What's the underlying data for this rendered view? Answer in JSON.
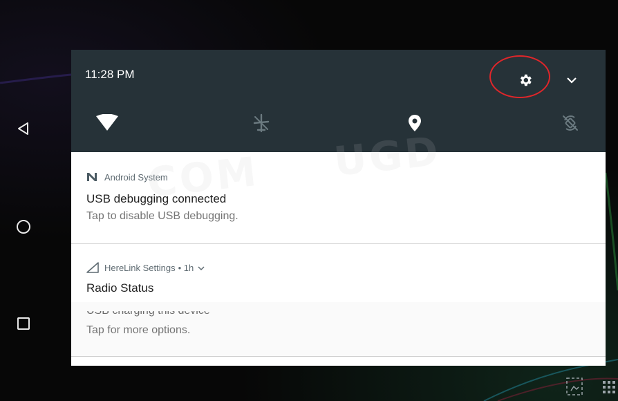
{
  "status": {
    "time": "11:28 PM"
  },
  "quick_settings": {
    "settings_icon": "gear-icon",
    "expand_icon": "chevron-down-icon",
    "tiles": [
      {
        "name": "wifi",
        "icon": "wifi-icon",
        "active": true
      },
      {
        "name": "airplane-mode",
        "icon": "airplane-icon",
        "active": false
      },
      {
        "name": "location",
        "icon": "location-pin-icon",
        "active": true
      },
      {
        "name": "auto-rotate",
        "icon": "rotate-off-icon",
        "active": false
      }
    ],
    "highlight_color": "#e0262a",
    "header_color": "#263238"
  },
  "notifications": [
    {
      "app": "Android System",
      "title": "USB debugging connected",
      "text": "Tap to disable USB debugging."
    },
    {
      "app": "HereLink Settings",
      "meta": "• 1h",
      "title": "Radio Status"
    },
    {
      "partial_title": "USB charging this device",
      "text": "Tap for more options."
    }
  ],
  "navigation": {
    "back": "back-icon",
    "home": "home-icon",
    "recents": "recents-icon"
  }
}
